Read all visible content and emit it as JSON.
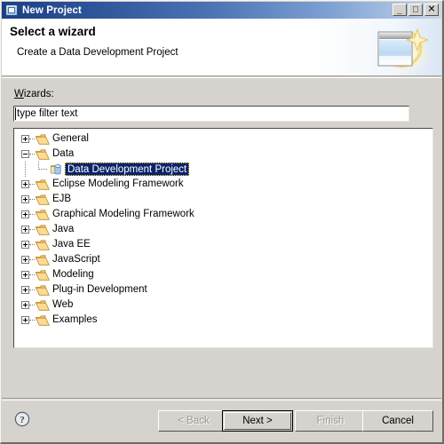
{
  "window": {
    "title": "New Project",
    "title_icon": "window-icon",
    "controls": [
      {
        "name": "minimize",
        "glyph": "_"
      },
      {
        "name": "maximize",
        "glyph": "□"
      },
      {
        "name": "close",
        "glyph": "✕"
      }
    ]
  },
  "header": {
    "title": "Select a wizard",
    "subtitle": "Create a Data Development Project",
    "banner_icon": "wizard-sparkle-window-icon"
  },
  "form": {
    "wizards_label_prefix": "",
    "wizards_label_mnemonic": "W",
    "wizards_label_rest": "izards:",
    "filter_value": "type filter text",
    "filter_placeholder": "type filter text"
  },
  "tree": {
    "items": [
      {
        "label": "General",
        "state": "collapsed",
        "icon": "folder-icon",
        "level": 0,
        "selected": false
      },
      {
        "label": "Data",
        "state": "expanded",
        "icon": "folder-icon",
        "level": 0,
        "selected": false
      },
      {
        "label": "Data Development Project",
        "state": "leaf",
        "icon": "database-project-icon",
        "level": 1,
        "selected": true
      },
      {
        "label": "Eclipse Modeling Framework",
        "state": "collapsed",
        "icon": "folder-icon",
        "level": 0,
        "selected": false
      },
      {
        "label": "EJB",
        "state": "collapsed",
        "icon": "folder-icon",
        "level": 0,
        "selected": false
      },
      {
        "label": "Graphical Modeling Framework",
        "state": "collapsed",
        "icon": "folder-icon",
        "level": 0,
        "selected": false
      },
      {
        "label": "Java",
        "state": "collapsed",
        "icon": "folder-icon",
        "level": 0,
        "selected": false
      },
      {
        "label": "Java EE",
        "state": "collapsed",
        "icon": "folder-icon",
        "level": 0,
        "selected": false
      },
      {
        "label": "JavaScript",
        "state": "collapsed",
        "icon": "folder-icon",
        "level": 0,
        "selected": false
      },
      {
        "label": "Modeling",
        "state": "collapsed",
        "icon": "folder-icon",
        "level": 0,
        "selected": false
      },
      {
        "label": "Plug-in Development",
        "state": "collapsed",
        "icon": "folder-icon",
        "level": 0,
        "selected": false
      },
      {
        "label": "Web",
        "state": "collapsed",
        "icon": "folder-icon",
        "level": 0,
        "selected": false
      },
      {
        "label": "Examples",
        "state": "collapsed",
        "icon": "folder-icon",
        "level": 0,
        "selected": false
      }
    ]
  },
  "footer": {
    "help_icon": "help-question-icon",
    "buttons": {
      "back": {
        "label": "< Back",
        "mnemonic": "B",
        "enabled": false,
        "default": false
      },
      "next": {
        "label": "Next >",
        "mnemonic": "N",
        "enabled": true,
        "default": true
      },
      "finish": {
        "label": "Finish",
        "mnemonic": "F",
        "enabled": false,
        "default": false
      },
      "cancel": {
        "label": "Cancel",
        "mnemonic": "",
        "enabled": true,
        "default": false
      }
    }
  },
  "colors": {
    "title_bar_start": "#1c3f87",
    "title_bar_end": "#cfd8e4",
    "dialog_face": "#d6d3ce",
    "selection_blue": "#0a246a",
    "folder_gold": "#f2bd50",
    "db_blue": "#7aa8d8"
  }
}
